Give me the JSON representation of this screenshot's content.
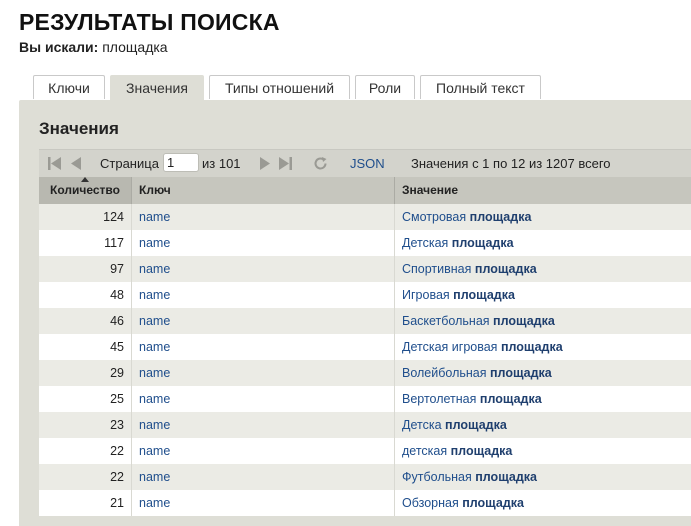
{
  "page": {
    "title": "РЕЗУЛЬТАТЫ ПОИСКА",
    "query_label": "Вы искали:",
    "query_value": "площадка"
  },
  "tabs": [
    {
      "label": "Ключи",
      "active": false
    },
    {
      "label": "Значения",
      "active": true
    },
    {
      "label": "Типы отношений",
      "active": false
    },
    {
      "label": "Роли",
      "active": false
    },
    {
      "label": "Полный текст",
      "active": false
    }
  ],
  "panel": {
    "title": "Значения"
  },
  "pager": {
    "page_label": "Страница",
    "page_value": "1",
    "of_label": "из 101",
    "json_label": "JSON",
    "summary": "Значения с 1 по 12 из 1207 всего"
  },
  "grid": {
    "columns": [
      "Количество",
      "Ключ",
      "Значение"
    ],
    "rows": [
      {
        "count": "124",
        "key": "name",
        "prefix": "Смотровая",
        "match": "площадка"
      },
      {
        "count": "117",
        "key": "name",
        "prefix": "Детская",
        "match": "площадка"
      },
      {
        "count": "97",
        "key": "name",
        "prefix": "Спортивная",
        "match": "площадка"
      },
      {
        "count": "48",
        "key": "name",
        "prefix": "Игровая",
        "match": "площадка"
      },
      {
        "count": "46",
        "key": "name",
        "prefix": "Баскетбольная",
        "match": "площадка"
      },
      {
        "count": "45",
        "key": "name",
        "prefix": "Детская игровая",
        "match": "площадка"
      },
      {
        "count": "29",
        "key": "name",
        "prefix": "Волейбольная",
        "match": "площадка"
      },
      {
        "count": "25",
        "key": "name",
        "prefix": "Вертолетная",
        "match": "площадка"
      },
      {
        "count": "23",
        "key": "name",
        "prefix": "Детска",
        "match": "площадка"
      },
      {
        "count": "22",
        "key": "name",
        "prefix": "детская",
        "match": "площадка"
      },
      {
        "count": "22",
        "key": "name",
        "prefix": "Футбольная",
        "match": "площадка"
      },
      {
        "count": "21",
        "key": "name",
        "prefix": "Обзорная",
        "match": "площадка"
      }
    ]
  }
}
